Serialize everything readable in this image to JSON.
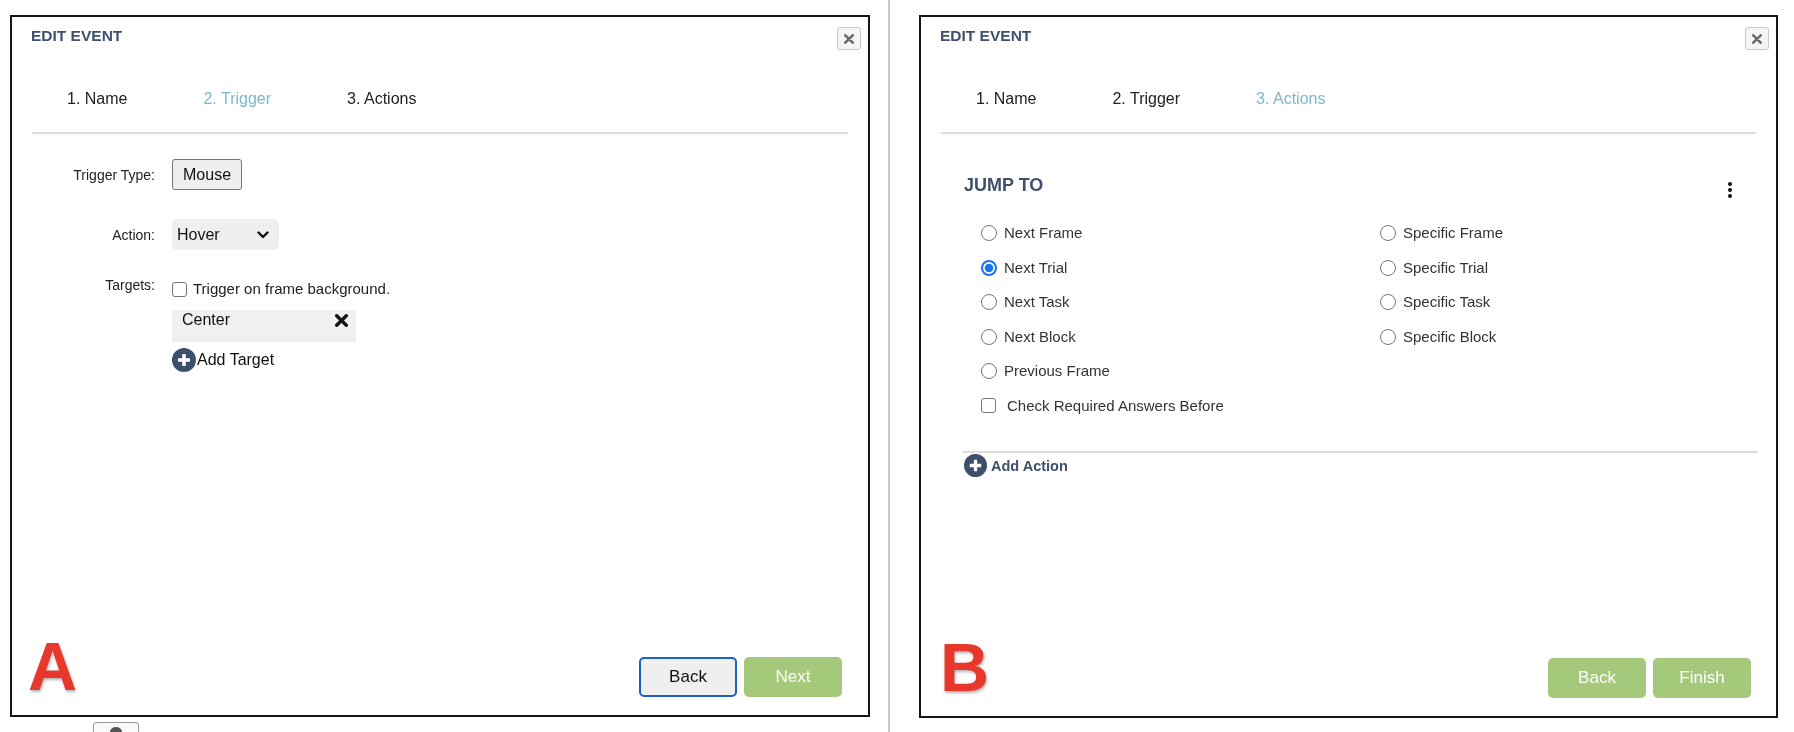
{
  "panels": [
    {
      "kind": "trigger",
      "title": "EDIT EVENT",
      "tabs": [
        {
          "label": "1. Name",
          "selected": false
        },
        {
          "label": "2. Trigger",
          "selected": true
        },
        {
          "label": "3. Actions",
          "selected": false
        }
      ],
      "trigger_type": {
        "label": "Trigger Type:",
        "value": "Mouse"
      },
      "action": {
        "label": "Action:",
        "value": "Hover"
      },
      "targets": {
        "label": "Targets:",
        "background": {
          "label": "Trigger on frame background.",
          "checked": false
        },
        "items": [
          "Center"
        ],
        "add_label": "Add Target"
      },
      "figure_label": "A",
      "buttons": [
        {
          "label": "Back",
          "kind": "secondary",
          "focused": true
        },
        {
          "label": "Next",
          "kind": "primary",
          "focused": false
        }
      ]
    },
    {
      "kind": "actions",
      "title": "EDIT EVENT",
      "tabs": [
        {
          "label": "1. Name",
          "selected": false
        },
        {
          "label": "2. Trigger",
          "selected": false
        },
        {
          "label": "3. Actions",
          "selected": true
        }
      ],
      "section": {
        "heading": "JUMP TO",
        "options": [
          {
            "label": "Next Frame",
            "selected": false
          },
          {
            "label": "Next Trial",
            "selected": true
          },
          {
            "label": "Next Task",
            "selected": false
          },
          {
            "label": "Next Block",
            "selected": false
          },
          {
            "label": "Previous Frame",
            "selected": false
          },
          {
            "label": "Specific Frame",
            "selected": false
          },
          {
            "label": "Specific Trial",
            "selected": false
          },
          {
            "label": "Specific Task",
            "selected": false
          },
          {
            "label": "Specific Block",
            "selected": false
          }
        ],
        "required_check": {
          "label": "Check Required Answers Before",
          "checked": false
        },
        "add_label": "Add Action"
      },
      "figure_label": "B",
      "buttons": [
        {
          "label": "Back",
          "kind": "primary",
          "focused": false
        },
        {
          "label": "Finish",
          "kind": "primary",
          "focused": false
        }
      ]
    }
  ]
}
